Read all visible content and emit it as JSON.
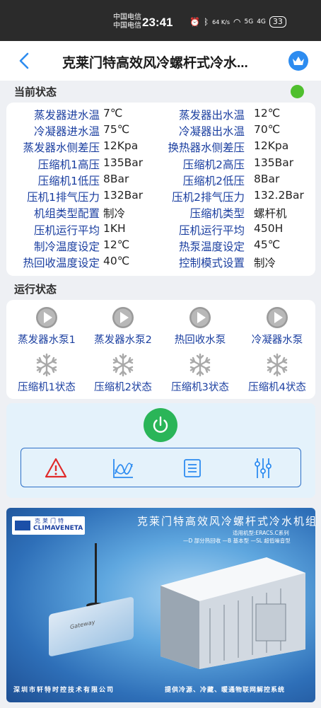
{
  "statusbar": {
    "carrier1": "中国电信",
    "carrier2": "中国电信",
    "time": "23:41",
    "net_speed": "64 K/s",
    "signal1": "5G",
    "signal2": "4G",
    "battery": "33"
  },
  "header": {
    "title": "克莱门特高效风冷螺杆式冷水..."
  },
  "current_status": {
    "section_title": "当前状态",
    "rows": [
      {
        "l1": "蒸发器进水温",
        "v1": "7℃",
        "l2": "蒸发器出水温",
        "v2": "12℃"
      },
      {
        "l1": "冷凝器进水温",
        "v1": "75℃",
        "l2": "冷凝器出水温",
        "v2": "70℃"
      },
      {
        "l1": "蒸发器水侧差压",
        "v1": "12Kpa",
        "l2": "换热器水侧差压",
        "v2": "12Kpa"
      },
      {
        "l1": "压缩机1高压",
        "v1": "135Bar",
        "l2": "压缩机2高压",
        "v2": "135Bar"
      },
      {
        "l1": "压缩机1低压",
        "v1": "8Bar",
        "l2": "压缩机2低压",
        "v2": "8Bar"
      },
      {
        "l1": "压机1排气压力",
        "v1": "132Bar",
        "l2": "压机2排气压力",
        "v2": "132.2Bar"
      },
      {
        "l1": "机组类型配置",
        "v1": "制冷",
        "l2": "压缩机类型",
        "v2": "螺杆机"
      },
      {
        "l1": "压机运行平均",
        "v1": "1KH",
        "l2": "压机运行平均",
        "v2": "450H"
      },
      {
        "l1": "制冷温度设定",
        "v1": "12℃",
        "l2": "热泵温度设定",
        "v2": "45℃"
      },
      {
        "l1": "热回收温度设定",
        "v1": "40℃",
        "l2": "控制模式设置",
        "v2": "制冷"
      }
    ]
  },
  "run_status": {
    "section_title": "运行状态",
    "pumps": [
      {
        "label": "蒸发器水泵1",
        "icon": "play-circle-icon"
      },
      {
        "label": "蒸发器水泵2",
        "icon": "play-circle-icon"
      },
      {
        "label": "热回收水泵",
        "icon": "play-circle-icon"
      },
      {
        "label": "冷凝器水泵",
        "icon": "play-circle-icon"
      }
    ],
    "compressors": [
      {
        "label": "压缩机1状态",
        "icon": "snowflake-icon"
      },
      {
        "label": "压缩机2状态",
        "icon": "snowflake-icon"
      },
      {
        "label": "压缩机3状态",
        "icon": "snowflake-icon"
      },
      {
        "label": "压缩机4状态",
        "icon": "snowflake-icon"
      }
    ]
  },
  "controls": {
    "power_icon": "power-icon",
    "tools": [
      "alarm-icon",
      "trend-chart-icon",
      "list-icon",
      "settings-sliders-icon"
    ]
  },
  "banner": {
    "logo_cn": "克莱门特",
    "logo_en": "CLIMAVENETA",
    "title": "克莱门特高效风冷螺杆式冷水机组",
    "subtitle1": "适用机型:ERACS.C系列",
    "subtitle2": "—D 部分热回收 —B 基本型 —SL 超低噪音型",
    "gateway_text": "Gateway",
    "footer_left": "深圳市轩特时控技术有限公司",
    "footer_right": "提供冷源、冷藏、暖通物联网解控系统"
  },
  "colors": {
    "label_blue": "#1b3fa0",
    "status_green": "#4fbf2e",
    "power_green": "#2ab558",
    "accent_blue": "#2d8cf0"
  }
}
